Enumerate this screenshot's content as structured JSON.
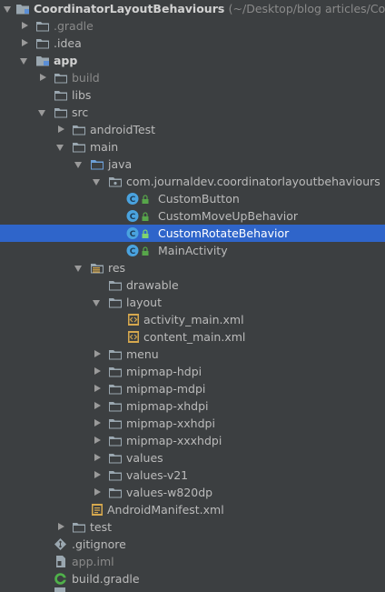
{
  "tree": {
    "root": {
      "label": "CoordinatorLayoutBehaviours",
      "path": "(~/Desktop/blog articles/Coordina"
    },
    "rows": [
      {
        "label": ".gradle"
      },
      {
        "label": ".idea"
      },
      {
        "label": "app"
      },
      {
        "label": "build"
      },
      {
        "label": "libs"
      },
      {
        "label": "src"
      },
      {
        "label": "androidTest"
      },
      {
        "label": "main"
      },
      {
        "label": "java"
      },
      {
        "label": "com.journaldev.coordinatorlayoutbehaviours"
      },
      {
        "label": "CustomButton"
      },
      {
        "label": "CustomMoveUpBehavior"
      },
      {
        "label": "CustomRotateBehavior"
      },
      {
        "label": "MainActivity"
      },
      {
        "label": "res"
      },
      {
        "label": "drawable"
      },
      {
        "label": "layout"
      },
      {
        "label": "activity_main.xml"
      },
      {
        "label": "content_main.xml"
      },
      {
        "label": "menu"
      },
      {
        "label": "mipmap-hdpi"
      },
      {
        "label": "mipmap-mdpi"
      },
      {
        "label": "mipmap-xhdpi"
      },
      {
        "label": "mipmap-xxhdpi"
      },
      {
        "label": "mipmap-xxxhdpi"
      },
      {
        "label": "values"
      },
      {
        "label": "values-v21"
      },
      {
        "label": "values-w820dp"
      },
      {
        "label": "AndroidManifest.xml"
      },
      {
        "label": "test"
      },
      {
        "label": ".gitignore"
      },
      {
        "label": "app.iml"
      },
      {
        "label": "build.gradle"
      }
    ],
    "selected": "CustomRotateBehavior"
  },
  "colors": {
    "background": "#3c3f41",
    "selection": "#2f65ca",
    "text": "#bbbbbb",
    "dim_text": "#8a8a8a",
    "folder": "#9aa7b0",
    "class_icon": "#4aa3df"
  },
  "icons": {
    "folder": "folder-icon",
    "module_folder": "module-folder-icon",
    "source_folder": "source-folder-icon",
    "package": "package-folder-icon",
    "resources_folder": "resources-folder-icon",
    "class": "class-icon",
    "xml_file": "xml-file-icon",
    "manifest": "manifest-file-icon",
    "git": "git-file-icon",
    "iml": "iml-file-icon",
    "gradle": "gradle-file-icon"
  }
}
